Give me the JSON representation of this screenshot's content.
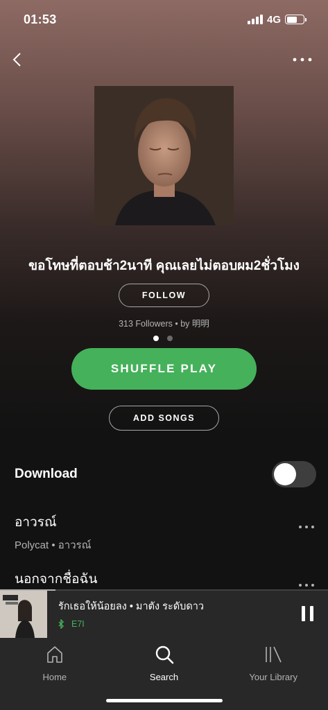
{
  "status_bar": {
    "time": "01:53",
    "network": "4G"
  },
  "playlist": {
    "title": "ขอโทษที่ตอบช้า2นาที คุณเลยไม่ตอบผม2ชั่วโมง",
    "follow_label": "FOLLOW",
    "followers_text": "313 Followers • by 明明",
    "page_count": 2,
    "active_page": 1
  },
  "actions": {
    "shuffle_label": "SHUFFLE PLAY",
    "add_songs_label": "ADD SONGS"
  },
  "download": {
    "label": "Download",
    "enabled": false
  },
  "tracks": [
    {
      "title": "อาวรณ์",
      "subtitle": "Polycat • อาวรณ์"
    },
    {
      "title": "นอกจากชื่อฉัน",
      "subtitle": ""
    }
  ],
  "now_playing": {
    "title": "รักเธอให้น้อยลง • มาตัง ระดับดาว",
    "device": "E7I",
    "progress": 0.17
  },
  "tabs": [
    {
      "label": "Home",
      "icon": "home-icon",
      "active": false
    },
    {
      "label": "Search",
      "icon": "search-icon",
      "active": true
    },
    {
      "label": "Your Library",
      "icon": "library-icon",
      "active": false
    }
  ],
  "colors": {
    "accent": "#45b15a",
    "background": "#121212",
    "header_tint": "#8e6a64"
  }
}
